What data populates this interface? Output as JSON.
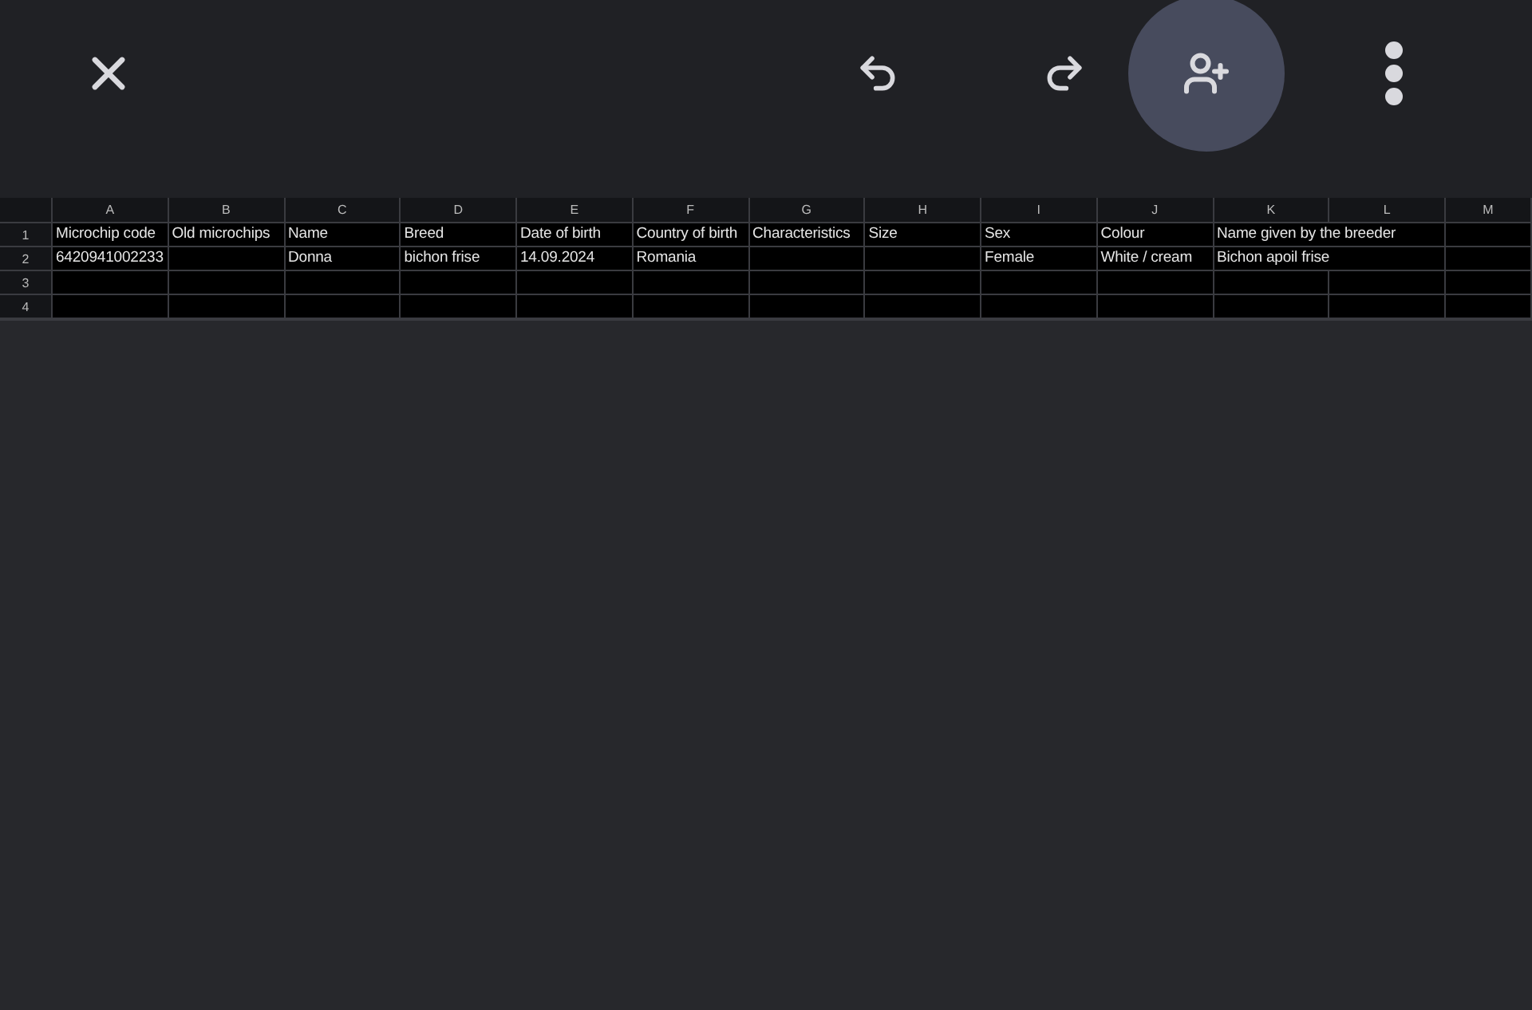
{
  "toolbar": {
    "buttons": [
      {
        "kind": "close"
      },
      {
        "kind": "undo"
      },
      {
        "kind": "redo"
      },
      {
        "kind": "share",
        "selected": true
      },
      {
        "kind": "more"
      }
    ]
  },
  "sheet": {
    "columns": [
      "A",
      "B",
      "C",
      "D",
      "E",
      "F",
      "G",
      "H",
      "I",
      "J",
      "K",
      "L",
      "M"
    ],
    "rows": [
      {
        "number": "1",
        "cells": {
          "A": "Microchip code",
          "B": "Old microchips",
          "C": "Name",
          "D": "Breed",
          "E": "Date of birth",
          "F": "Country of birth",
          "G": "Characteristics",
          "H": "Size",
          "I": "Sex",
          "J": "Colour",
          "K": "Name given by the breeder"
        }
      },
      {
        "number": "2",
        "cells": {
          "A": "6420941002233",
          "C": "Donna",
          "D": "bichon frise",
          "E": "14.09.2024",
          "F": "Romania",
          "I": "Female",
          "J": "White / cream",
          "K": "Bichon apoil frise"
        }
      },
      {
        "number": "3",
        "cells": {}
      },
      {
        "number": "4",
        "cells": {}
      }
    ]
  }
}
